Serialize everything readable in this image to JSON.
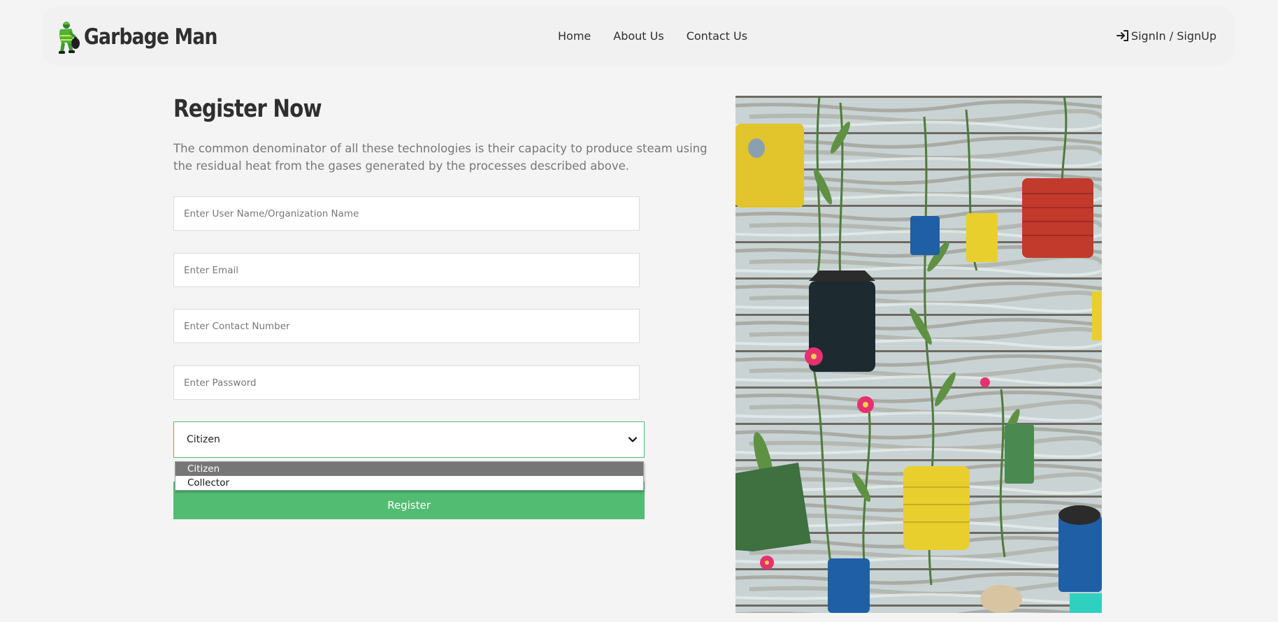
{
  "header": {
    "brand_name": "Garbage Man",
    "nav": [
      "Home",
      "About Us",
      "Contact Us"
    ],
    "signin_label": "SignIn / SignUp"
  },
  "form": {
    "title": "Register Now",
    "description": "The common denominator of all these technologies is their capacity to produce steam using the residual heat from the gases generated by the processes described above.",
    "fields": {
      "username_placeholder": "Enter User Name/Organization Name",
      "email_placeholder": "Enter Email",
      "contact_placeholder": "Enter Contact Number",
      "password_placeholder": "Enter Password"
    },
    "role_select": {
      "selected": "Citizen",
      "options": [
        "Citizen",
        "Collector"
      ]
    },
    "register_label": "Register"
  },
  "colors": {
    "accent": "#52bd72",
    "background": "#f4f4f4",
    "text": "#2f2f2f",
    "muted_text": "#777777"
  },
  "icons": {
    "logo": "garbage-man-logo-icon",
    "signin": "sign-in-arrow-icon",
    "select": "chevron-down-icon"
  }
}
